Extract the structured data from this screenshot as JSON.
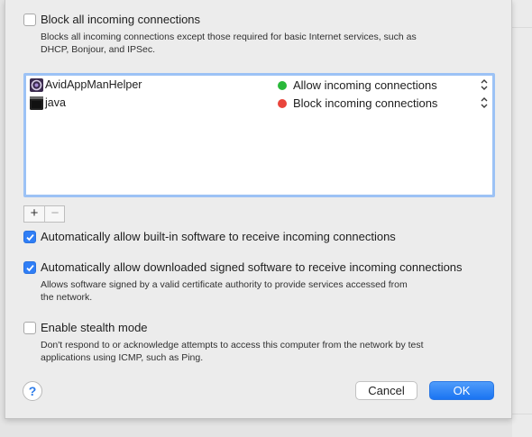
{
  "block_all": {
    "label": "Block all incoming connections",
    "description_line1": "Blocks all incoming connections except those required for basic Internet services, such as",
    "description_line2": "DHCP, Bonjour, and IPSec.",
    "checked": false
  },
  "app_list": [
    {
      "name": "AvidAppManHelper",
      "icon": "avid-app-icon",
      "status": "Allow incoming connections",
      "status_color": "#29b83a"
    },
    {
      "name": "java",
      "icon": "terminal-icon",
      "status": "Block incoming connections",
      "status_color": "#e9443b"
    }
  ],
  "list_controls": {
    "add": "+",
    "remove": "−"
  },
  "auto_builtin": {
    "label": "Automatically allow built-in software to receive incoming connections",
    "checked": true
  },
  "auto_signed": {
    "label": "Automatically allow downloaded signed software to receive incoming connections",
    "description_line1": "Allows software signed by a valid certificate authority to provide services accessed from",
    "description_line2": "the network.",
    "checked": true
  },
  "stealth": {
    "label": "Enable stealth mode",
    "description_line1": "Don't respond to or acknowledge attempts to access this computer from the network by test",
    "description_line2": "applications using ICMP, such as Ping.",
    "checked": false
  },
  "footer": {
    "help": "?",
    "cancel": "Cancel",
    "ok": "OK"
  },
  "colors": {
    "accent": "#2f7ef6",
    "allow": "#29b83a",
    "block": "#e9443b",
    "focus_ring": "#9cc2f5"
  }
}
